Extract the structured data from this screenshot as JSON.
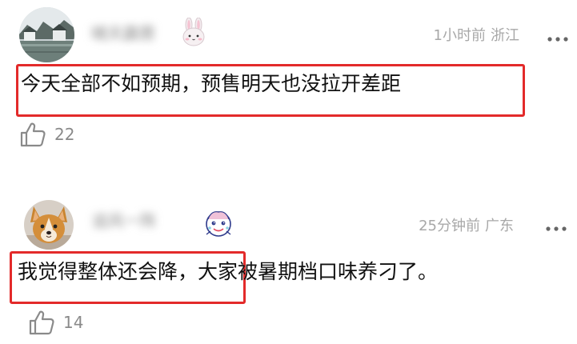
{
  "comments": [
    {
      "username": "晴天霹雳",
      "time": "1小时前",
      "location": "浙江",
      "text": "今天全部不如预期，预售明天也没拉开差距",
      "highlighted_text": "今天全部不如预期，预售明天也没拉开差距",
      "likes": "22",
      "avatar_icon": "town-scene-avatar",
      "badge_icon": "rabbit-icon"
    },
    {
      "username": "追风一阵",
      "time": "25分钟前",
      "location": "广东",
      "text_highlighted": "我觉得整体还会降，",
      "text_rest": "大家被暑期档口味养刁了。",
      "likes": "14",
      "avatar_icon": "dog-avatar",
      "badge_icon": "cartoon-badge-icon"
    }
  ],
  "colors": {
    "highlight_border": "#e32a2a",
    "meta_text": "#a8a8a8",
    "body_text": "#111111"
  }
}
